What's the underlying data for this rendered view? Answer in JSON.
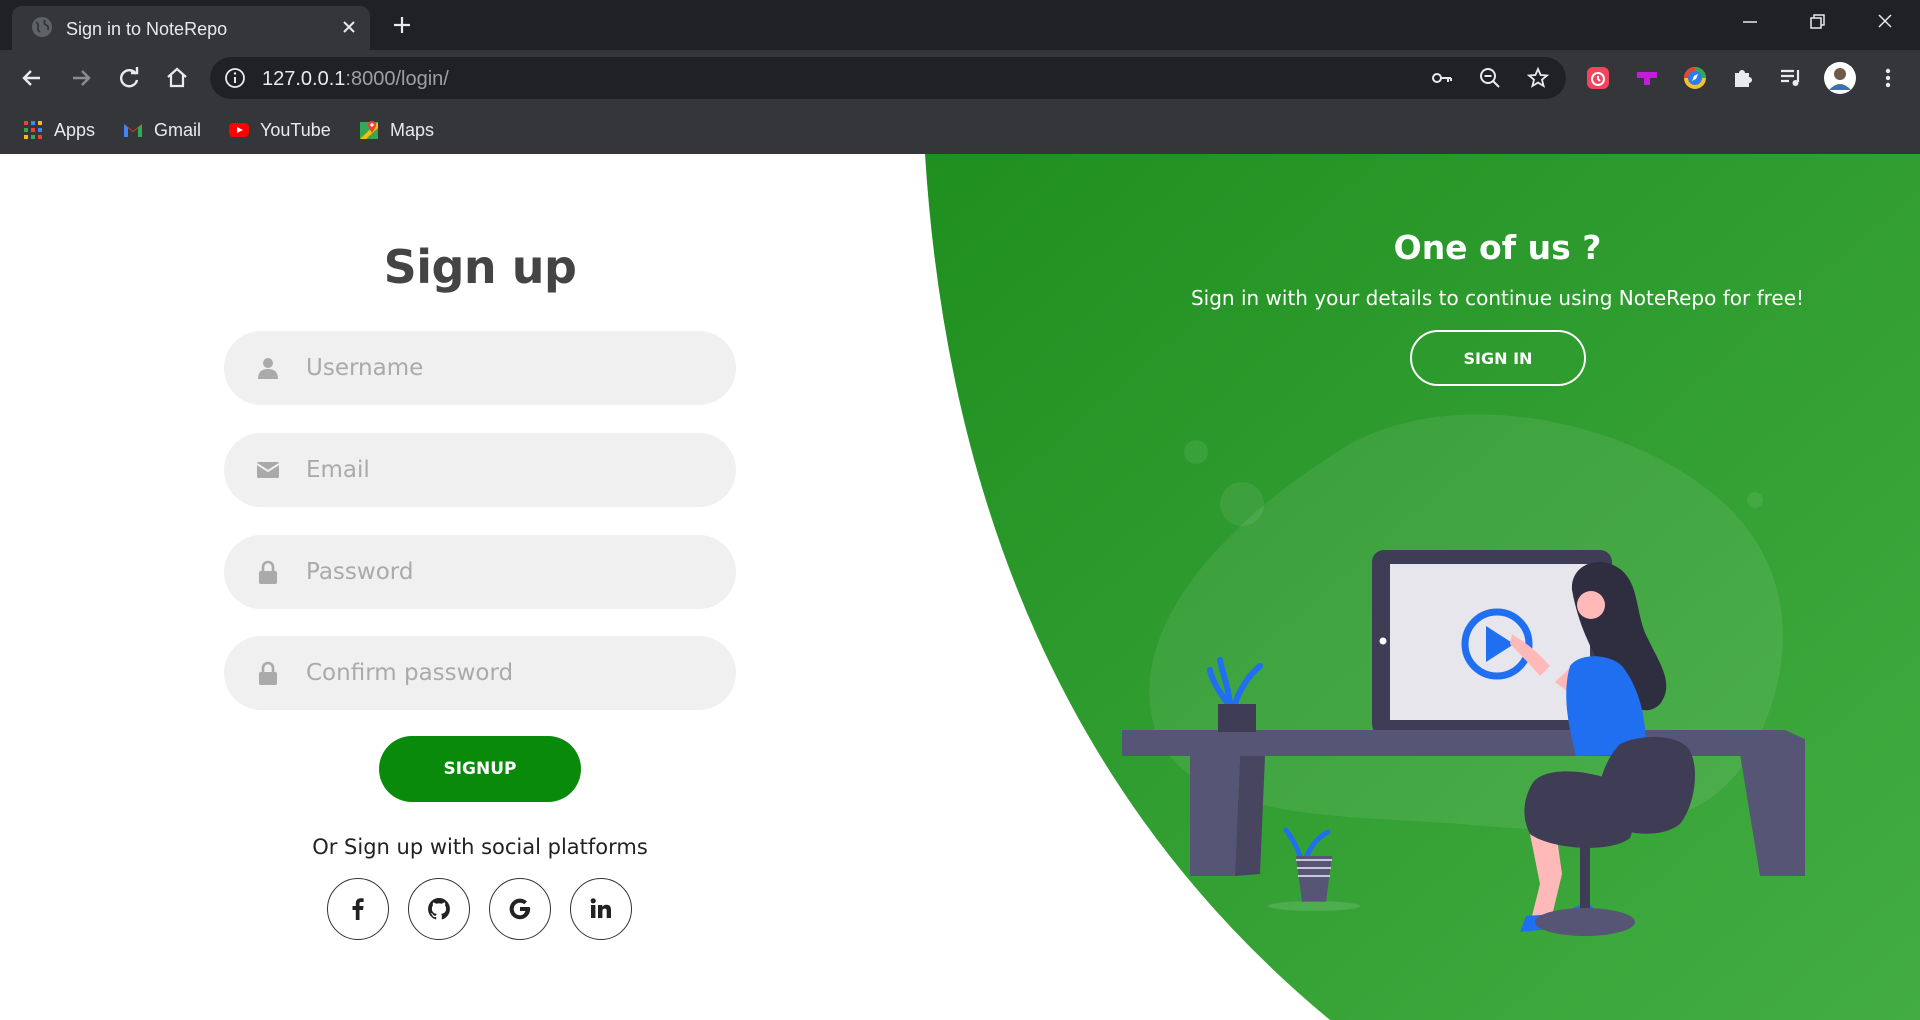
{
  "browser": {
    "tab_title": "Sign in to NoteRepo",
    "url_host": "127.0.0.1",
    "url_rest": ":8000/login/",
    "bookmarks": [
      {
        "label": "Apps",
        "icon": "apps-grid-icon"
      },
      {
        "label": "Gmail",
        "icon": "gmail-icon"
      },
      {
        "label": "YouTube",
        "icon": "youtube-icon"
      },
      {
        "label": "Maps",
        "icon": "maps-icon"
      }
    ]
  },
  "signup_form": {
    "title": "Sign up",
    "username_placeholder": "Username",
    "email_placeholder": "Email",
    "password_placeholder": "Password",
    "confirm_password_placeholder": "Confirm password",
    "submit_label": "SIGNUP",
    "social_text": "Or Sign up with social platforms",
    "social_icons": [
      "facebook-icon",
      "github-icon",
      "google-icon",
      "linkedin-icon"
    ]
  },
  "signin_panel": {
    "title": "One of us ?",
    "text": "Sign in with your details to continue using NoteRepo for free!",
    "button_label": "SIGN IN"
  },
  "colors": {
    "brand_green": "#0a8a0a",
    "panel_green_light": "#3aa83a",
    "panel_green_dark": "#1f8f1f",
    "field_bg": "#f0f0f0",
    "accent_blue": "#1f6ff0"
  }
}
